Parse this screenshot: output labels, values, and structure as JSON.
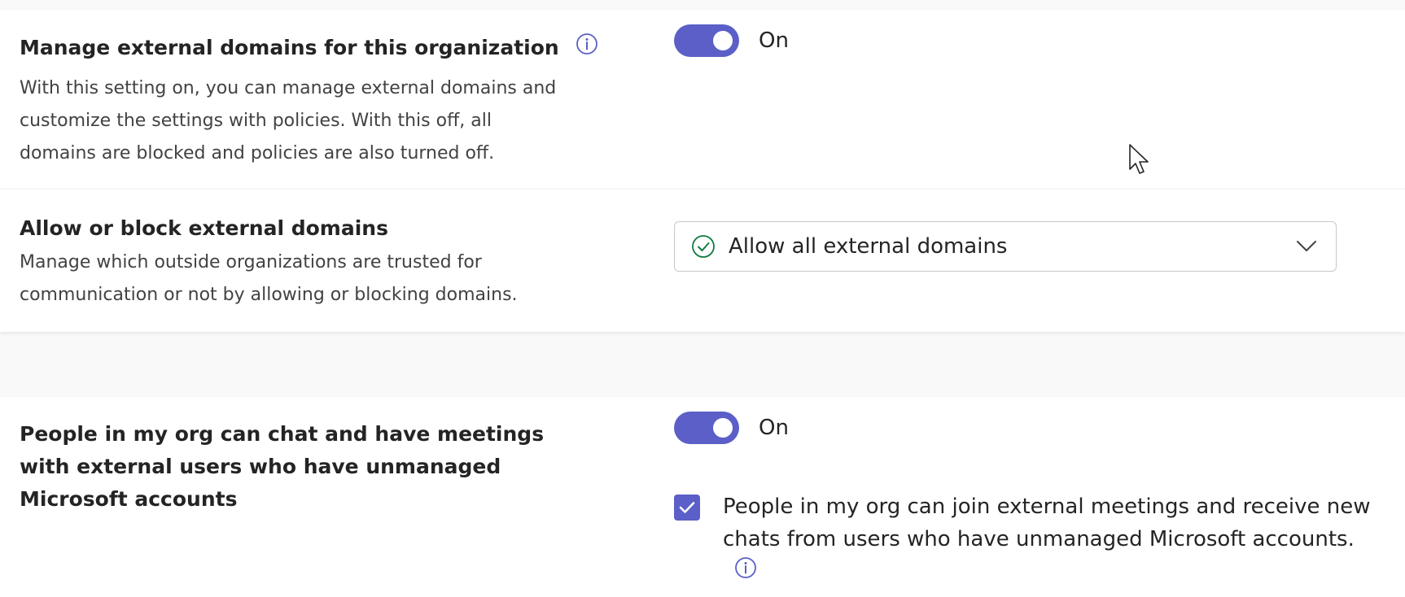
{
  "colors": {
    "accent": "#5b5fc7",
    "success": "#107c41",
    "text": "#242424",
    "muted": "#424242",
    "background": "#f9f9f9"
  },
  "manage_domains": {
    "title": "Manage external domains for this organization",
    "description": "With this setting on, you can manage external domains and customize the settings with policies. With this off, all domains are blocked and policies are also turned off.",
    "toggle_state": "On",
    "info_icon": "info-icon"
  },
  "allow_block": {
    "title": "Allow or block external domains",
    "description": "Manage which outside organizations are trusted for communication or not by allowing or blocking domains.",
    "dropdown_value": "Allow all external domains",
    "dropdown_icon": "check-circle-icon"
  },
  "unmanaged_accounts": {
    "title": "People in my org can chat and have meetings with external users who have unmanaged Microsoft accounts",
    "toggle_state": "On",
    "checkbox_checked": true,
    "checkbox_label": "People in my org can join external meetings and receive new chats from users who have unmanaged Microsoft accounts.",
    "info_icon": "info-icon"
  }
}
